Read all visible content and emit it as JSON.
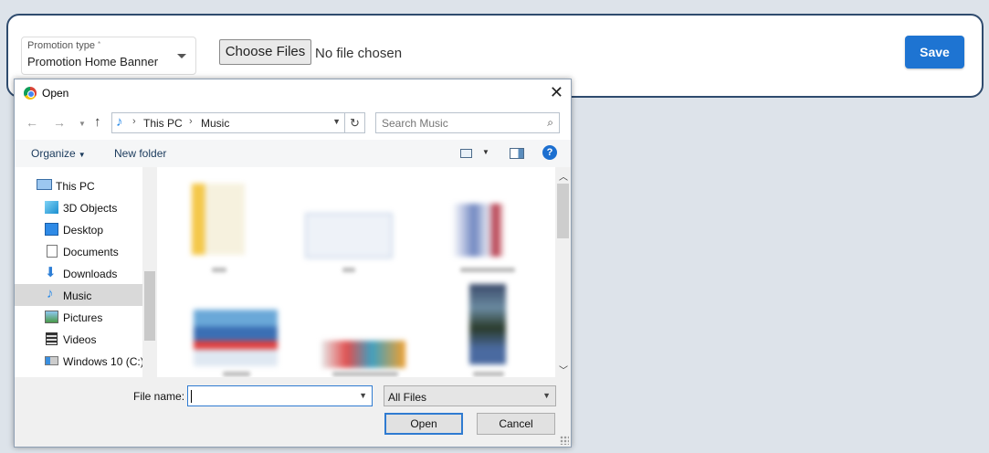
{
  "form": {
    "promotion_type_label": "Promotion type",
    "required_mark": "*",
    "promotion_type_value": "Promotion Home Banner",
    "choose_files_label": "Choose Files",
    "no_file_text": "No file chosen",
    "save_label": "Save"
  },
  "dialog": {
    "title": "Open",
    "close_glyph": "✕",
    "nav": {
      "back": "←",
      "forward": "→",
      "up": "↑"
    },
    "breadcrumb": [
      "This PC",
      "Music"
    ],
    "search_placeholder": "Search Music",
    "toolbar": {
      "organize": "Organize",
      "new_folder": "New folder",
      "help": "?"
    },
    "sidebar": {
      "items": [
        {
          "label": "This PC",
          "icon": "pc-icon"
        },
        {
          "label": "3D Objects",
          "icon": "cube-icon"
        },
        {
          "label": "Desktop",
          "icon": "desktop-icon"
        },
        {
          "label": "Documents",
          "icon": "document-icon"
        },
        {
          "label": "Downloads",
          "icon": "download-icon"
        },
        {
          "label": "Music",
          "icon": "music-icon",
          "selected": true
        },
        {
          "label": "Pictures",
          "icon": "pictures-icon"
        },
        {
          "label": "Videos",
          "icon": "videos-icon"
        },
        {
          "label": "Windows 10 (C:)",
          "icon": "drive-icon"
        }
      ]
    },
    "file_name_label": "File name:",
    "file_name_value": "",
    "file_type": "All Files",
    "open_label": "Open",
    "cancel_label": "Cancel"
  },
  "colors": {
    "accent": "#1e74d2",
    "card_border": "#2f4b6e",
    "background": "#dde3ea",
    "selection": "#d9d9d9"
  }
}
